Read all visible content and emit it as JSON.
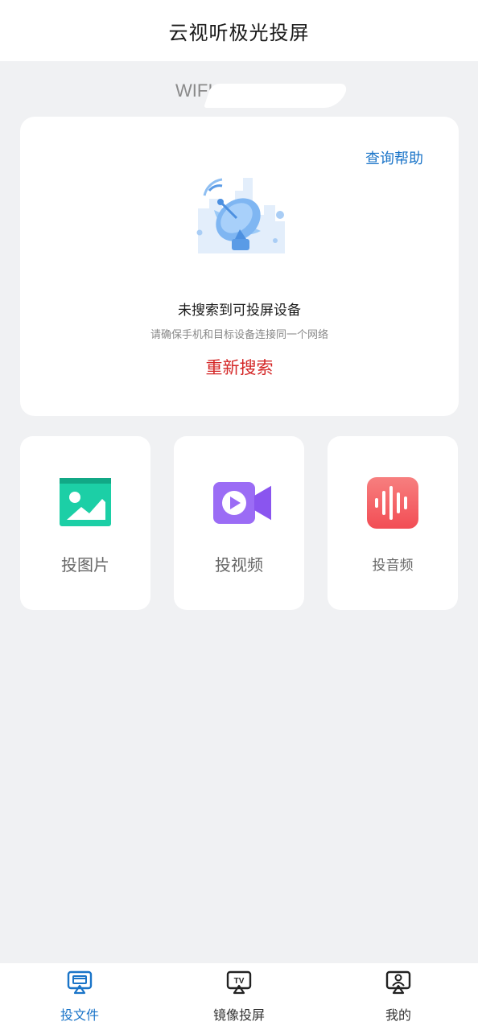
{
  "header": {
    "title": "云视听极光投屏"
  },
  "wifi": {
    "label": "WIFI"
  },
  "search_card": {
    "help_label": "查询帮助",
    "empty_title": "未搜索到可投屏设备",
    "empty_subtitle": "请确保手机和目标设备连接同一个网络",
    "retry_label": "重新搜索"
  },
  "tiles": [
    {
      "label": "投图片",
      "icon": "image-icon",
      "color": "#1ccfa6"
    },
    {
      "label": "投视频",
      "icon": "video-camera-icon",
      "color": "#9b6cf5"
    },
    {
      "label": "投音频",
      "icon": "audio-wave-icon",
      "color": "#f45a5a"
    }
  ],
  "tabbar": {
    "items": [
      {
        "label": "投文件",
        "icon": "cast-file-icon",
        "active": true
      },
      {
        "label": "镜像投屏",
        "icon": "tv-mirror-icon",
        "active": false
      },
      {
        "label": "我的",
        "icon": "profile-icon",
        "active": false
      }
    ]
  },
  "colors": {
    "accent": "#1a74c8",
    "retry": "#d42626",
    "background": "#f0f1f3"
  }
}
